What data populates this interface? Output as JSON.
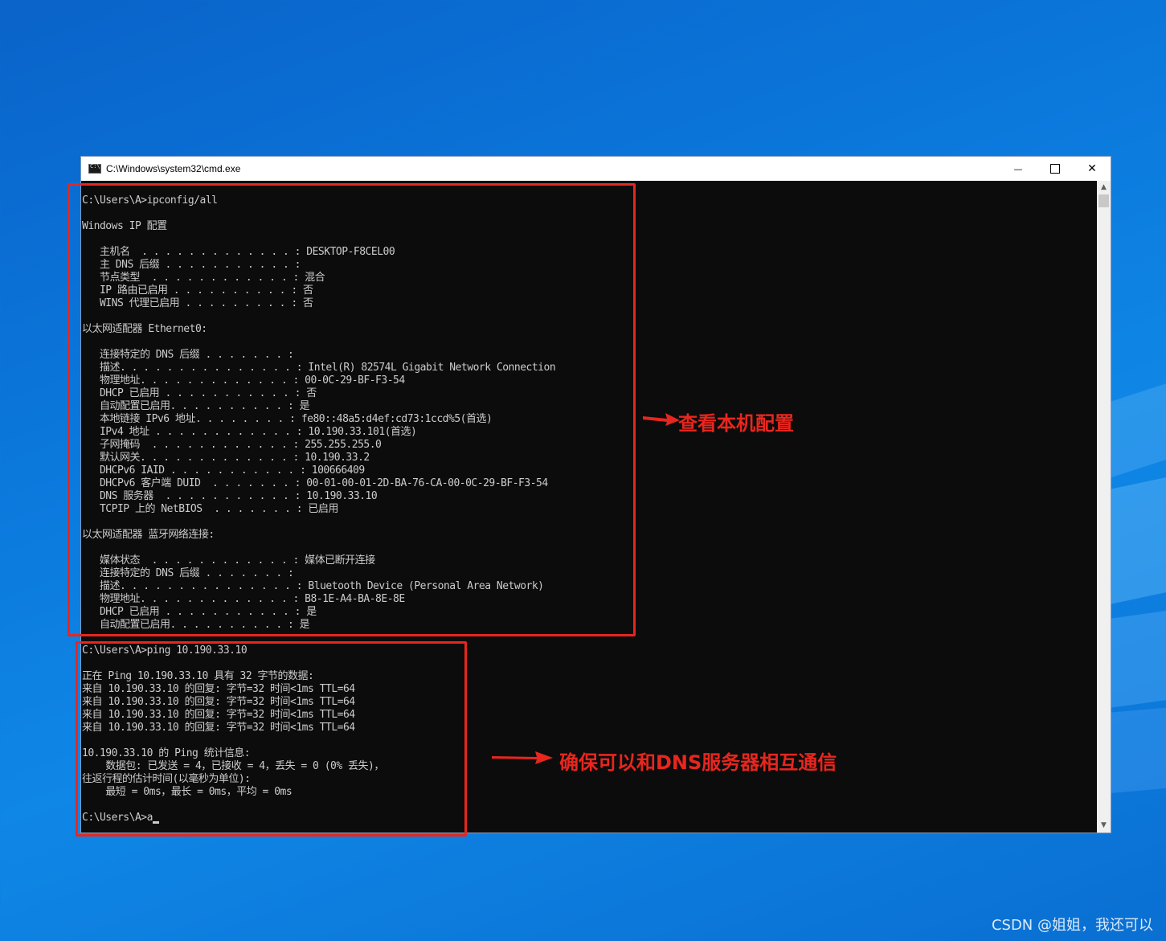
{
  "window": {
    "title": "C:\\Windows\\system32\\cmd.exe",
    "minimize": "—",
    "close": "✕"
  },
  "console_lines": [
    "C:\\Users\\A>ipconfig/all",
    "",
    "Windows IP 配置",
    "",
    "   主机名  . . . . . . . . . . . . . : DESKTOP-F8CEL00",
    "   主 DNS 后缀 . . . . . . . . . . . :",
    "   节点类型  . . . . . . . . . . . . : 混合",
    "   IP 路由已启用 . . . . . . . . . . : 否",
    "   WINS 代理已启用 . . . . . . . . . : 否",
    "",
    "以太网适配器 Ethernet0:",
    "",
    "   连接特定的 DNS 后缀 . . . . . . . :",
    "   描述. . . . . . . . . . . . . . . : Intel(R) 82574L Gigabit Network Connection",
    "   物理地址. . . . . . . . . . . . . : 00-0C-29-BF-F3-54",
    "   DHCP 已启用 . . . . . . . . . . . : 否",
    "   自动配置已启用. . . . . . . . . . : 是",
    "   本地链接 IPv6 地址. . . . . . . . : fe80::48a5:d4ef:cd73:1ccd%5(首选)",
    "   IPv4 地址 . . . . . . . . . . . . : 10.190.33.101(首选)",
    "   子网掩码  . . . . . . . . . . . . : 255.255.255.0",
    "   默认网关. . . . . . . . . . . . . : 10.190.33.2",
    "   DHCPv6 IAID . . . . . . . . . . . : 100666409",
    "   DHCPv6 客户端 DUID  . . . . . . . : 00-01-00-01-2D-BA-76-CA-00-0C-29-BF-F3-54",
    "   DNS 服务器  . . . . . . . . . . . : 10.190.33.10",
    "   TCPIP 上的 NetBIOS  . . . . . . . : 已启用",
    "",
    "以太网适配器 蓝牙网络连接:",
    "",
    "   媒体状态  . . . . . . . . . . . . : 媒体已断开连接",
    "   连接特定的 DNS 后缀 . . . . . . . :",
    "   描述. . . . . . . . . . . . . . . : Bluetooth Device (Personal Area Network)",
    "   物理地址. . . . . . . . . . . . . : B8-1E-A4-BA-8E-8E",
    "   DHCP 已启用 . . . . . . . . . . . : 是",
    "   自动配置已启用. . . . . . . . . . : 是",
    "",
    "C:\\Users\\A>ping 10.190.33.10",
    "",
    "正在 Ping 10.190.33.10 具有 32 字节的数据:",
    "来自 10.190.33.10 的回复: 字节=32 时间<1ms TTL=64",
    "来自 10.190.33.10 的回复: 字节=32 时间<1ms TTL=64",
    "来自 10.190.33.10 的回复: 字节=32 时间<1ms TTL=64",
    "来自 10.190.33.10 的回复: 字节=32 时间<1ms TTL=64",
    "",
    "10.190.33.10 的 Ping 统计信息:",
    "    数据包: 已发送 = 4，已接收 = 4，丢失 = 0 (0% 丢失)，",
    "往返行程的估计时间(以毫秒为单位):",
    "    最短 = 0ms，最长 = 0ms，平均 = 0ms",
    "",
    "C:\\Users\\A>a"
  ],
  "annotations": {
    "config_label": "查看本机配置",
    "ping_label": "确保可以和DNS服务器相互通信",
    "color": "#e8261e"
  },
  "watermark": "CSDN @姐姐，我还可以"
}
